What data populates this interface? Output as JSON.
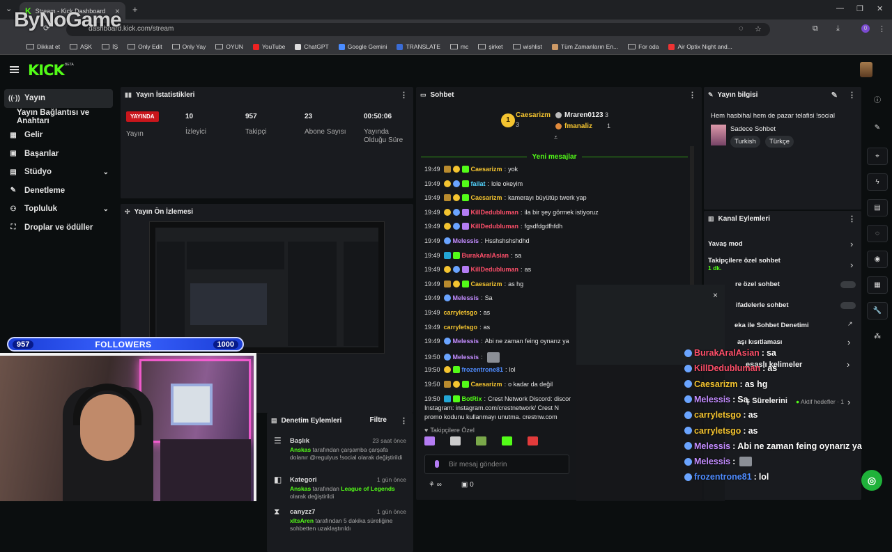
{
  "browser": {
    "tab_title": "Stream - Kick Dashboard",
    "url": "dashboard.kick.com/stream",
    "watermark": "ByNoGame",
    "bookmarks": [
      "Dikkat et",
      "AŞK",
      "İŞ",
      "Only Edit",
      "Only Yay",
      "OYUN",
      "YouTube",
      "ChatGPT",
      "Google Gemini",
      "TRANSLATE",
      "mc",
      "şirket",
      "wishlist",
      "Tüm Zamanların En...",
      "For oda",
      "Air Optix Night and..."
    ],
    "profile_initial": "0"
  },
  "app": {
    "logo": "KICK",
    "logo_sup": "BETA"
  },
  "sidebar": {
    "items": [
      {
        "label": "Yayın",
        "icon": "broadcast-icon"
      },
      {
        "label": "Yayın Bağlantısı ve Anahtarı"
      },
      {
        "label": "Gelir",
        "icon": "revenue-icon"
      },
      {
        "label": "Başarılar",
        "icon": "achievements-icon"
      },
      {
        "label": "Stüdyo",
        "icon": "studio-icon"
      },
      {
        "label": "Denetleme",
        "icon": "wrench-icon"
      },
      {
        "label": "Topluluk",
        "icon": "community-icon"
      },
      {
        "label": "Droplar ve ödüller",
        "icon": "drops-icon"
      }
    ]
  },
  "stats": {
    "title": "Yayın İstatistikleri",
    "live_badge": "YAYINDA",
    "live_label": "Yayın",
    "items": [
      {
        "value": "10",
        "label": "İzleyici"
      },
      {
        "value": "957",
        "label": "Takipçi"
      },
      {
        "value": "23",
        "label": "Abone Sayısı"
      },
      {
        "value": "00:50:06",
        "label": "Yayında Olduğu Süre"
      }
    ]
  },
  "preview": {
    "title": "Yayın Ön İzlemesi"
  },
  "followers_bar": {
    "current": "957",
    "label": "FOLLOWERS",
    "goal": "1000"
  },
  "modlog": {
    "title": "Denetim Eylemleri",
    "filter": "Filtre",
    "entries": [
      {
        "title": "Başlık",
        "time": "23 saat önce",
        "actor": "Anskas",
        "text": "tarafından çarşamba çarşafa dolanır @regulyus !social olarak değiştirildi"
      },
      {
        "title": "Kategori",
        "time": "1 gün önce",
        "actor": "Anskas",
        "text": "tarafından",
        "highlight": "League of Legends",
        "text2": "olarak değiştirildi"
      },
      {
        "title": "canyzz7",
        "time": "1 gün önce",
        "actor": "xltsAren",
        "text": "tarafından 5 dakika süreliğine sohbetten uzaklaştırıldı"
      }
    ]
  },
  "chat": {
    "title": "Sohbet",
    "top_gifters": [
      {
        "name": "Caesarizm",
        "count": "3"
      },
      {
        "name": "Mraren0123",
        "count": "3"
      },
      {
        "name": "fmanaliz",
        "count": "1"
      }
    ],
    "new_messages": "Yeni mesajlar",
    "messages": [
      {
        "time": "19:49",
        "user": "Caesarizm",
        "color": "#f4c430",
        "text": "yok",
        "badges": [
          "crown",
          "one",
          "gift"
        ]
      },
      {
        "time": "19:49",
        "user": "failat",
        "color": "#53d5ff",
        "text": "lole okeyim",
        "badges": [
          "one",
          "dot",
          "gift"
        ]
      },
      {
        "time": "19:49",
        "user": "Caesarizm",
        "color": "#f4c430",
        "text": "kamerayı büyütüp twerk yap",
        "badges": [
          "crown",
          "one",
          "gift"
        ]
      },
      {
        "time": "19:49",
        "user": "KillDedubluman",
        "color": "#ff4f6a",
        "text": "ila bir şey görmek istiyoruz",
        "badges": [
          "one",
          "dot",
          "sub"
        ]
      },
      {
        "time": "19:49",
        "user": "KillDedubluman",
        "color": "#ff4f6a",
        "text": "fgsdfdgdfhfdh",
        "badges": [
          "one",
          "dot",
          "sub"
        ]
      },
      {
        "time": "19:49",
        "user": "Melessis",
        "color": "#c38cff",
        "text": "Hsshshshshdhd",
        "badges": [
          "dot"
        ]
      },
      {
        "time": "19:49",
        "user": "BurakAralAsian",
        "color": "#ff4f6a",
        "text": "sa",
        "badges": [
          "bot",
          "gift"
        ]
      },
      {
        "time": "19:49",
        "user": "KillDedubluman",
        "color": "#ff4f6a",
        "text": "as",
        "badges": [
          "one",
          "dot",
          "sub"
        ]
      },
      {
        "time": "19:49",
        "user": "Caesarizm",
        "color": "#f4c430",
        "text": "as hg",
        "badges": [
          "crown",
          "one",
          "gift"
        ]
      },
      {
        "time": "19:49",
        "user": "Melessis",
        "color": "#c38cff",
        "text": "Sa",
        "badges": [
          "dot"
        ]
      },
      {
        "time": "19:49",
        "user": "carryletsgo",
        "color": "#f4c430",
        "text": "as",
        "badges": []
      },
      {
        "time": "19:49",
        "user": "carryletsgo",
        "color": "#f4c430",
        "text": "as",
        "badges": []
      },
      {
        "time": "19:49",
        "user": "Melessis",
        "color": "#c38cff",
        "text": "Abi ne zaman feing oynarız ya",
        "badges": [
          "dot"
        ]
      },
      {
        "time": "19:50",
        "user": "Melessis",
        "color": "#c38cff",
        "text": "",
        "badges": [
          "dot"
        ]
      },
      {
        "time": "19:50",
        "user": "frozentrone81",
        "color": "#4f8cff",
        "text": "lol",
        "badges": [
          "one",
          "gift"
        ]
      },
      {
        "time": "19:50",
        "user": "Caesarizm",
        "color": "#f4c430",
        "text": "o kadar da değil",
        "badges": [
          "crown",
          "one",
          "gift"
        ]
      },
      {
        "time": "19:50",
        "user": "BotRix",
        "color": "#53fc18",
        "text": "Crest Network Discord: discor",
        "badges": [
          "bot",
          "gift"
        ]
      }
    ],
    "botrix_line2": "Instagram: instagram.com/crestnetwork/ Crest N",
    "botrix_line3": "promo kodunu kullanmayı unutma. crestnw.com",
    "followers_only": "Takipçilere Özel",
    "input_placeholder": "Bir mesaj gönderin",
    "footer_count": "0"
  },
  "stream_info": {
    "title": "Yayın bilgisi",
    "stream_title": "Hem hasbihal hem de pazar telafisi !social",
    "category": "Sadece Sohbet",
    "tags": [
      "Turkish",
      "Türkçe"
    ]
  },
  "channel_actions": {
    "title": "Kanal Eylemleri",
    "items": [
      {
        "label": "Yavaş mod"
      },
      {
        "label": "Takipçilere özel sohbet",
        "sub": "1 dk."
      },
      {
        "label": "re özel sohbet"
      },
      {
        "label": "ifadelerle sohbet"
      },
      {
        "label": "eka ile Sohbet Denetimi"
      },
      {
        "label": "aşı kısıtlaması"
      },
      {
        "label": "esaslı kelimeler"
      },
      {
        "label": "ş Sürelerini"
      },
      {
        "label": "Aktif hedefler · 1"
      }
    ]
  },
  "overlay_chat": [
    {
      "user": "BurakAralAsian",
      "color": "#ff4f6a",
      "text": "sa"
    },
    {
      "user": "KillDedubluman",
      "color": "#ff4f6a",
      "text": "as"
    },
    {
      "user": "Caesarizm",
      "color": "#f4c430",
      "text": "as hg"
    },
    {
      "user": "Melessis",
      "color": "#c38cff",
      "text": "Sa"
    },
    {
      "user": "carryletsgo",
      "color": "#f4c430",
      "text": "as"
    },
    {
      "user": "carryletsgo",
      "color": "#f4c430",
      "text": "as"
    },
    {
      "user": "Melessis",
      "color": "#c38cff",
      "text": "Abi ne zaman feing oynarız ya"
    },
    {
      "user": "Melessis",
      "color": "#c38cff",
      "text": ""
    },
    {
      "user": "frozentrone81",
      "color": "#4f8cff",
      "text": "lol"
    }
  ]
}
